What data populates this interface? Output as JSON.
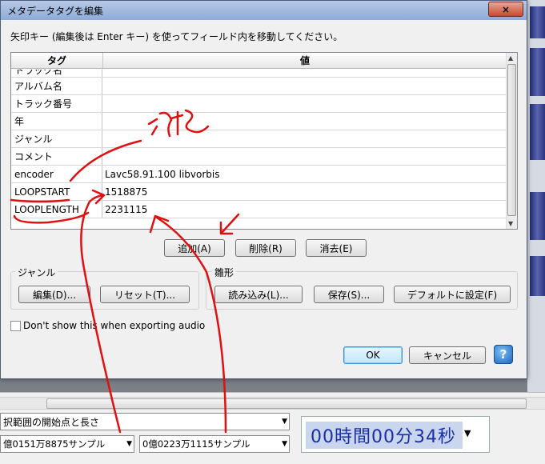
{
  "dialog": {
    "title": "メタデータタグを編集",
    "close_glyph": "×",
    "instruction": "矢印キー (編集後は Enter キー) を使ってフィールド内を移動してください。",
    "columns": [
      "タグ",
      "値"
    ],
    "rows": [
      {
        "tag": "トラック名",
        "value": ""
      },
      {
        "tag": "アルバム名",
        "value": ""
      },
      {
        "tag": "トラック番号",
        "value": ""
      },
      {
        "tag": "年",
        "value": ""
      },
      {
        "tag": "ジャンル",
        "value": ""
      },
      {
        "tag": "コメント",
        "value": ""
      },
      {
        "tag": "encoder",
        "value": "Lavc58.91.100 libvorbis"
      },
      {
        "tag": "LOOPSTART",
        "value": "1518875"
      },
      {
        "tag": "LOOPLENGTH",
        "value": "2231115"
      }
    ],
    "buttons": {
      "add": "追加(A)",
      "delete": "削除(R)",
      "clear": "消去(E)"
    },
    "genre_group": {
      "label": "ジャンル",
      "edit": "編集(D)...",
      "reset": "リセット(T)..."
    },
    "template_group": {
      "label": "雛形",
      "load": "読み込み(L)...",
      "save": "保存(S)...",
      "set_default": "デフォルトに設定(F)"
    },
    "checkbox_label": "Don't show this when exporting audio",
    "checkbox_checked": false,
    "ok": "OK",
    "cancel": "キャンセル",
    "help": "?"
  },
  "background": {
    "selection_combo": "択範囲の開始点と長さ",
    "start_combo": "億0151万8875サンプル",
    "length_combo": "0億0223万1115サンプル",
    "time_display": "00時間00分34秒"
  },
  "annotation": {
    "text": "追記",
    "color": "#e01010"
  },
  "icons": {
    "dropdown": "dropdown-arrow-icon",
    "help": "help-icon",
    "close": "close-icon"
  }
}
